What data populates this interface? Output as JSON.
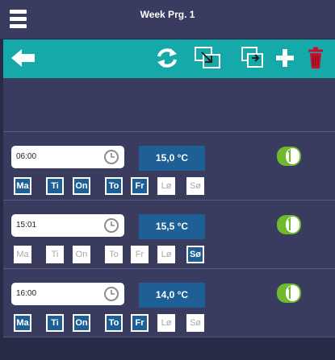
{
  "header": {
    "title": "Week Prg. 1",
    "menu_icon": "hamburger-menu-icon"
  },
  "toolbar": {
    "back_icon": "arrow-left-icon",
    "refresh_icon": "refresh-icon",
    "copy_icon": "copy-schedule-icon",
    "paste_icon": "paste-schedule-icon",
    "add_icon": "plus-icon",
    "delete_icon": "trash-icon"
  },
  "colors": {
    "accent": "#16a9aa",
    "temp_box": "#1e5f96",
    "toggle_on": "#6fba2c",
    "delete": "#c8102e"
  },
  "entries": [
    {
      "time": "06:00",
      "temp": "15,0 °C",
      "enabled": true,
      "days": [
        {
          "label": "Ma",
          "active": true
        },
        {
          "label": "Ti",
          "active": true
        },
        {
          "label": "On",
          "active": true
        },
        {
          "label": "To",
          "active": true
        },
        {
          "label": "Fr",
          "active": true
        },
        {
          "label": "Lø",
          "active": false
        },
        {
          "label": "Sø",
          "active": false
        }
      ]
    },
    {
      "time": "15:01",
      "temp": "15,5 °C",
      "enabled": true,
      "days": [
        {
          "label": "Ma",
          "active": false
        },
        {
          "label": "Ti",
          "active": false
        },
        {
          "label": "On",
          "active": false
        },
        {
          "label": "To",
          "active": false
        },
        {
          "label": "Fr",
          "active": false
        },
        {
          "label": "Lø",
          "active": false
        },
        {
          "label": "Sø",
          "active": true
        }
      ]
    },
    {
      "time": "16:00",
      "temp": "14,0 °C",
      "enabled": true,
      "days": [
        {
          "label": "Ma",
          "active": true
        },
        {
          "label": "Ti",
          "active": true
        },
        {
          "label": "On",
          "active": true
        },
        {
          "label": "To",
          "active": true
        },
        {
          "label": "Fr",
          "active": true
        },
        {
          "label": "Lø",
          "active": false
        },
        {
          "label": "Sø",
          "active": false
        }
      ]
    }
  ]
}
